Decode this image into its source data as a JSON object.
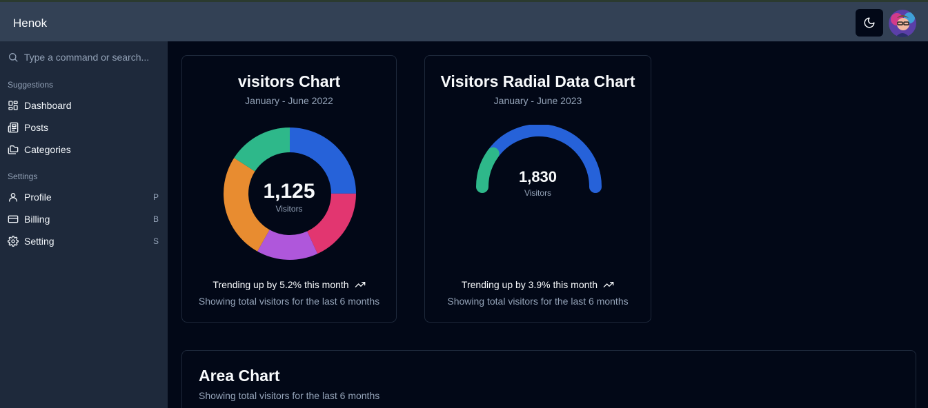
{
  "header": {
    "brand": "Henok"
  },
  "search": {
    "placeholder": "Type a command or search..."
  },
  "sidebar": {
    "groups": [
      {
        "title": "Suggestions",
        "items": [
          {
            "label": "Dashboard",
            "icon": "dashboard-icon"
          },
          {
            "label": "Posts",
            "icon": "newspaper-icon"
          },
          {
            "label": "Categories",
            "icon": "folders-icon"
          }
        ]
      },
      {
        "title": "Settings",
        "items": [
          {
            "label": "Profile",
            "icon": "user-icon",
            "shortcut": "P"
          },
          {
            "label": "Billing",
            "icon": "credit-card-icon",
            "shortcut": "B"
          },
          {
            "label": "Setting",
            "icon": "gear-icon",
            "shortcut": "S"
          }
        ]
      }
    ]
  },
  "cards": {
    "pie": {
      "title": "visitors Chart",
      "subtitle": "January - June 2022",
      "total": "1,125",
      "total_label": "Visitors",
      "trend": "Trending up by 5.2% this month",
      "footer": "Showing total visitors for the last 6 months"
    },
    "radial": {
      "title": "Visitors Radial Data Chart",
      "subtitle": "January - June 2023",
      "total": "1,830",
      "total_label": "Visitors",
      "trend": "Trending up by 3.9% this month",
      "footer": "Showing total visitors for the last 6 months"
    },
    "area": {
      "title": "Area Chart",
      "subtitle": "Showing total visitors for the last 6 months"
    }
  },
  "chart_data": [
    {
      "type": "pie",
      "donut": true,
      "total": 1125,
      "slices": [
        {
          "value": 281,
          "color": "#2662d9"
        },
        {
          "value": 204,
          "color": "#e23670"
        },
        {
          "value": 169,
          "color": "#af57db"
        },
        {
          "value": 292,
          "color": "#e88c30"
        },
        {
          "value": 179,
          "color": "#2eb88a"
        }
      ]
    },
    {
      "type": "radial",
      "total": 1830,
      "series": [
        {
          "value": 1464,
          "color": "#2662d9"
        },
        {
          "value": 366,
          "color": "#2eb88a"
        }
      ]
    }
  ],
  "colors": {
    "background": "#020817",
    "sidebar": "#1e293b",
    "topbar": "#334155",
    "muted": "#94a3b8"
  }
}
